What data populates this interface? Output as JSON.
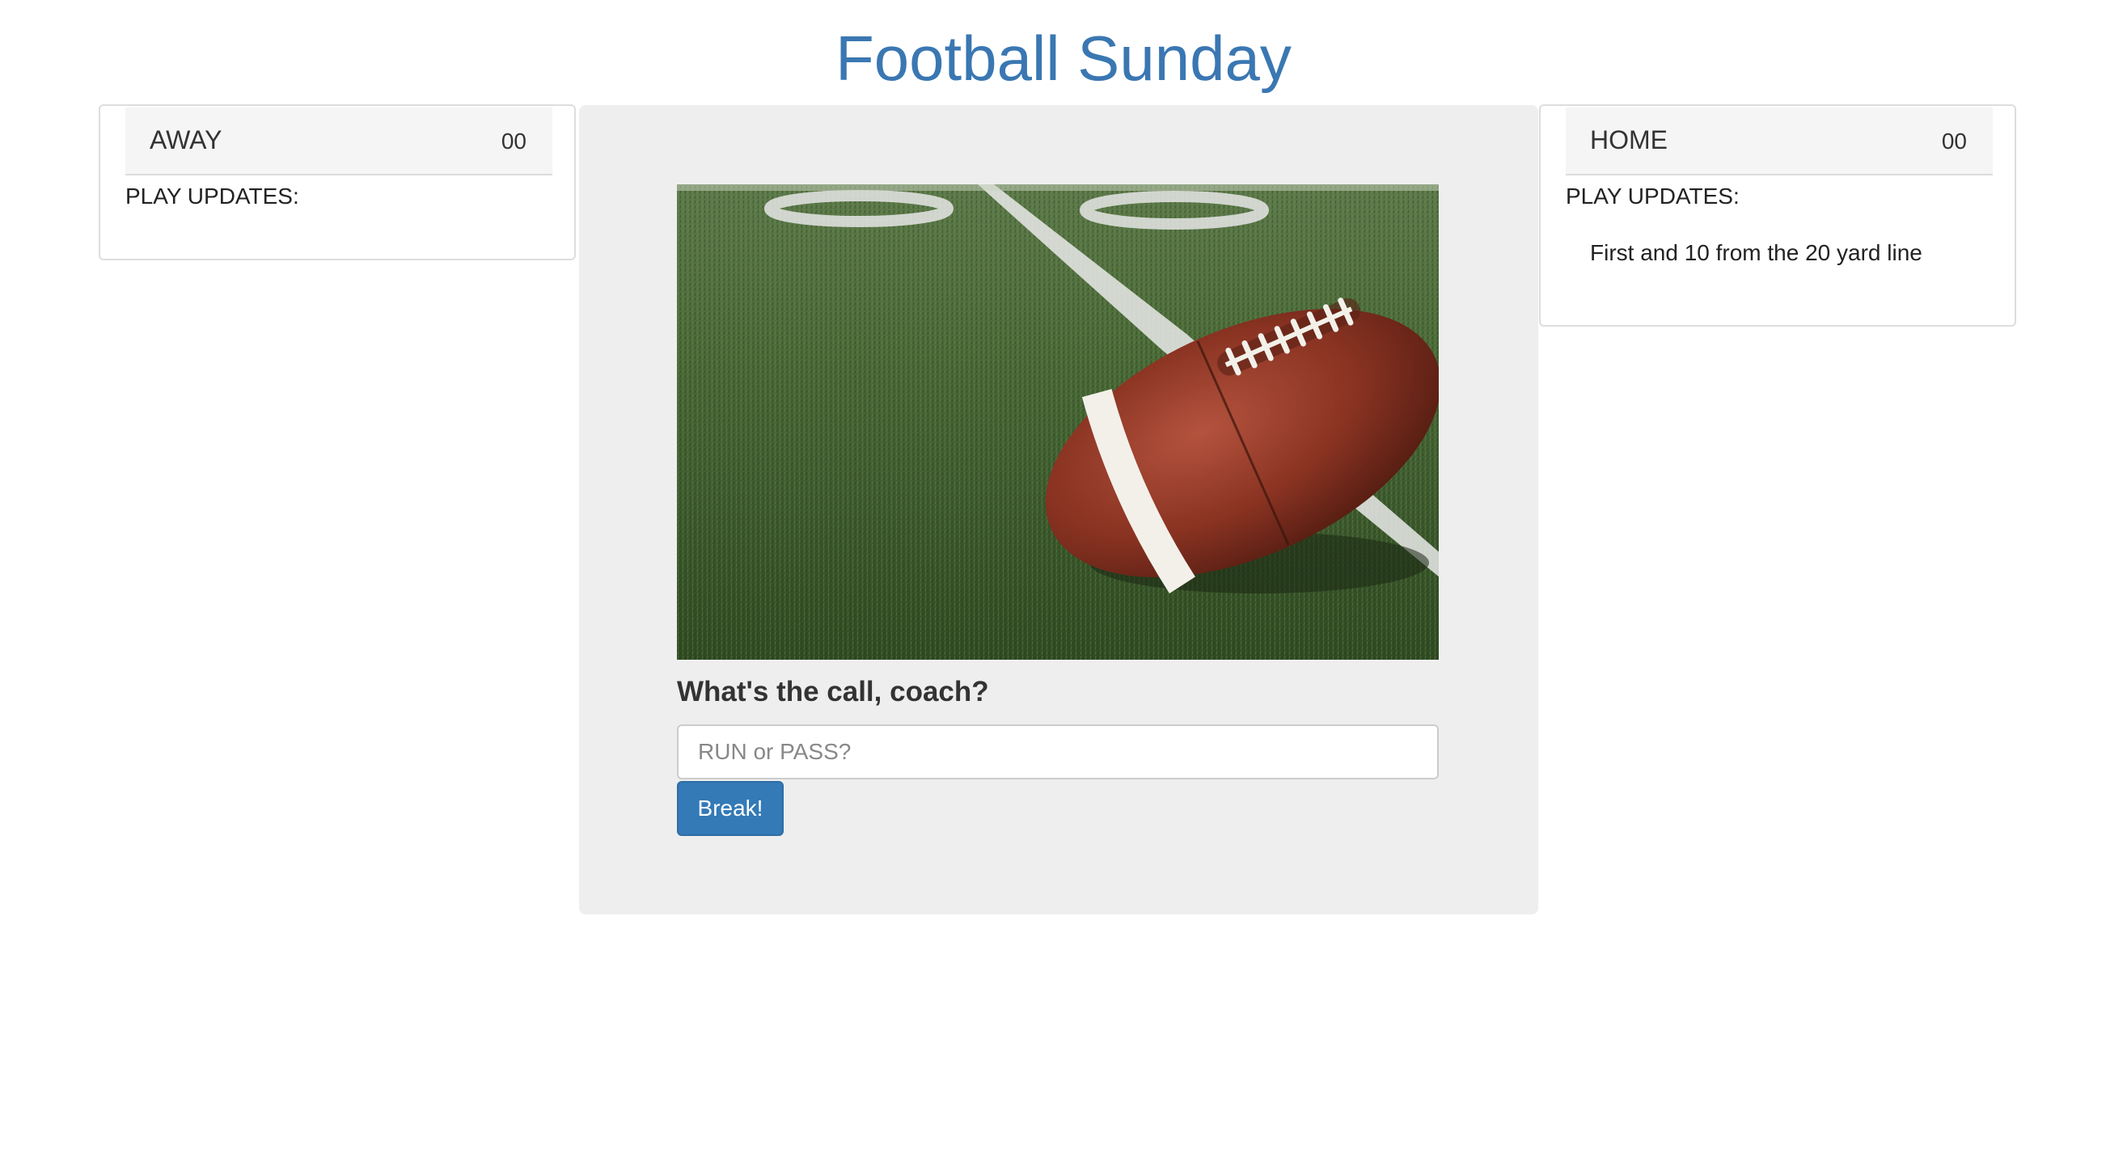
{
  "app": {
    "title": "Football Sunday"
  },
  "away": {
    "name": "AWAY",
    "score": "00",
    "updates_label": "PLAY UPDATES:",
    "updates": []
  },
  "home": {
    "name": "HOME",
    "score": "00",
    "updates_label": "PLAY UPDATES:",
    "updates": [
      "First and 10 from the 20 yard line"
    ]
  },
  "play_call": {
    "image_icon": "football-on-field-photo",
    "question": "What's the call, coach?",
    "input_placeholder": "RUN or PASS?",
    "input_value": "",
    "button_label": "Break!"
  },
  "colors": {
    "title": "#3a77b2",
    "button": "#337ab7",
    "center_card": "#eeeeee",
    "panel_header": "#f5f5f5"
  }
}
